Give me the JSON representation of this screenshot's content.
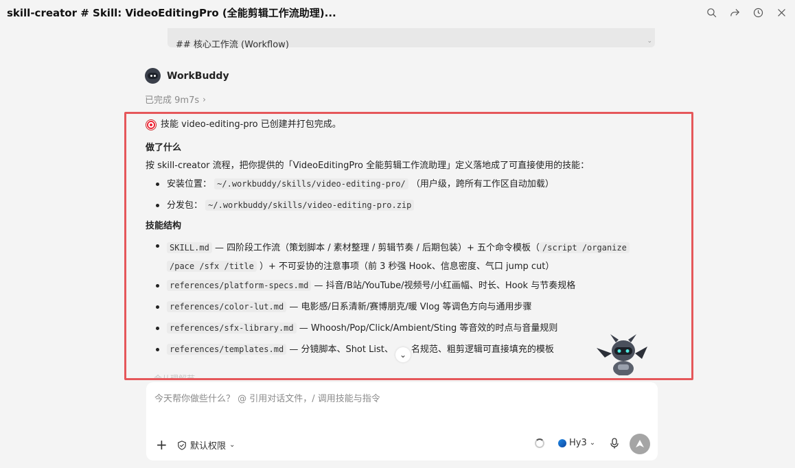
{
  "header": {
    "title": "skill-creator # Skill: VideoEditingPro (全能剪辑工作流助理)..."
  },
  "previous_message": {
    "text": "## 核心工作流 (Workflow)"
  },
  "assistant": {
    "name": "WorkBuddy",
    "status": "已完成 9m7s"
  },
  "content": {
    "intro": "技能 video-editing-pro 已创建并打包完成。",
    "section1_title": "做了什么",
    "section1_para": "按 skill-creator 流程，把你提供的「VideoEditingPro 全能剪辑工作流助理」定义落地成了可直接使用的技能：",
    "bullets1": [
      {
        "label": "安装位置：",
        "code": "~/.workbuddy/skills/video-editing-pro/",
        "suffix": "（用户级，跨所有工作区自动加载）"
      },
      {
        "label": "分发包：",
        "code": "~/.workbuddy/skills/video-editing-pro.zip",
        "suffix": ""
      }
    ],
    "section2_title": "技能结构",
    "bullets2": [
      {
        "code": "SKILL.md",
        "text": "— 四阶段工作流（策划脚本 / 素材整理 / 剪辑节奏 / 后期包装）+ 五个命令模板（",
        "code2": "/script  /organize",
        "line2_code": "/pace  /sfx  /title",
        "line2_text": "）+ 不可妥协的注意事项（前 3 秒强 Hook、信息密度、气口 jump cut）"
      },
      {
        "code": "references/platform-specs.md",
        "text": "— 抖音/B站/YouTube/视频号/小红画幅、时长、Hook 与节奏规格"
      },
      {
        "code": "references/color-lut.md",
        "text": "— 电影感/日系清新/赛博朋克/暖 Vlog 等调色方向与通用步骤"
      },
      {
        "code": "references/sfx-library.md",
        "text": "— Whoosh/Pop/Click/Ambient/Sting 等音效的时点与音量规则"
      },
      {
        "code": "references/templates.md",
        "text": "— 分镜脚本、Shot List、",
        "text_after": "名规范、粗剪逻辑可直接填充的模板"
      }
    ],
    "faded_text": "会从理解节"
  },
  "composer": {
    "placeholder": "今天帮你做些什么？  @ 引用对话文件，/ 调用技能与指令",
    "permission_label": "默认权限",
    "model_label": "Hy3"
  },
  "icons": {
    "topbar": [
      "search-icon",
      "share-icon",
      "history-icon",
      "close-icon"
    ]
  },
  "colors": {
    "highlight_border": "#e5575a",
    "send_button": "#a5a5a5"
  }
}
